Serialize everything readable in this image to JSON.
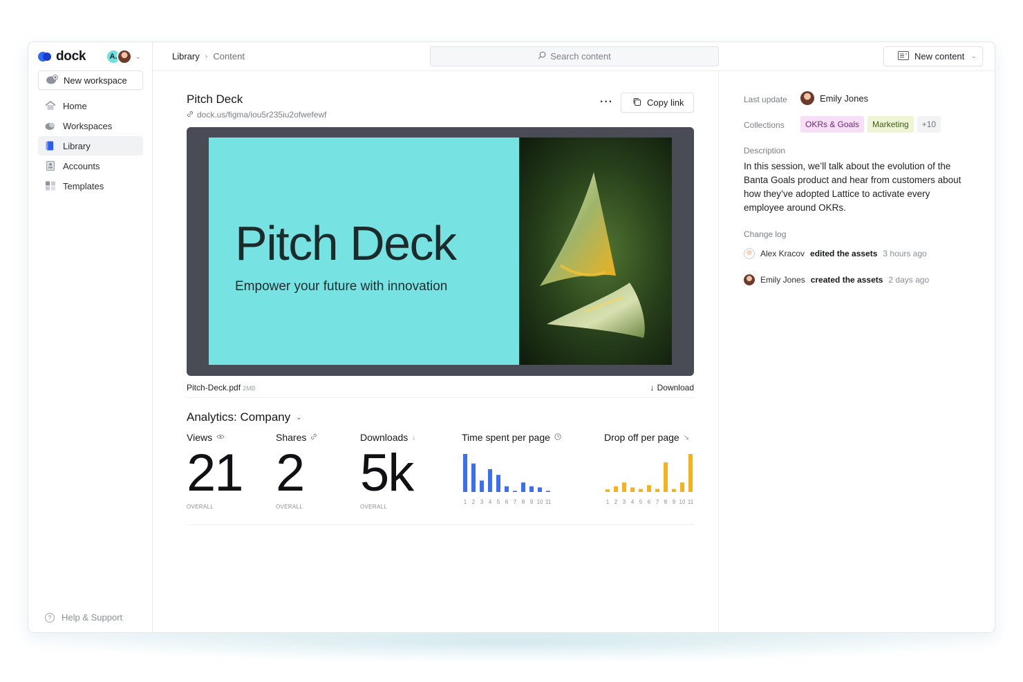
{
  "app": {
    "logo_text": "dock",
    "avatar_initial": "A."
  },
  "sidebar": {
    "new_workspace": "New workspace",
    "items": [
      {
        "label": "Home",
        "icon": "home-icon"
      },
      {
        "label": "Workspaces",
        "icon": "workspaces-icon"
      },
      {
        "label": "Library",
        "icon": "library-icon",
        "active": true
      },
      {
        "label": "Accounts",
        "icon": "accounts-icon"
      },
      {
        "label": "Templates",
        "icon": "templates-icon"
      }
    ],
    "help": "Help & Support"
  },
  "topbar": {
    "breadcrumb": [
      "Library",
      "Content"
    ],
    "search_placeholder": "Search content",
    "new_content": "New content"
  },
  "document": {
    "title": "Pitch Deck",
    "url": "dock.us/figma/iou5r235iu2ofwefewf",
    "copy_link": "Copy link",
    "slide_title": "Pitch Deck",
    "slide_subtitle": "Empower your future with innovation",
    "file_name": "Pitch-Deck.pdf",
    "file_size": "2MB",
    "download": "Download"
  },
  "analytics": {
    "heading": "Analytics: Company",
    "metrics": [
      {
        "label": "Views",
        "value": "21",
        "sub": "OVERALL",
        "icon": "eye-icon"
      },
      {
        "label": "Shares",
        "value": "2",
        "sub": "OVERALL",
        "icon": "link-icon"
      },
      {
        "label": "Downloads",
        "value": "5k",
        "sub": "OVERALL",
        "icon": "arrow-down-icon"
      }
    ],
    "time_label": "Time spent per page",
    "drop_label": "Drop off per page"
  },
  "chart_data": [
    {
      "type": "bar",
      "title": "Time spent per page",
      "categories": [
        "1",
        "2",
        "3",
        "4",
        "5",
        "6",
        "7",
        "8",
        "9",
        "10",
        "11"
      ],
      "values": [
        10,
        7.5,
        3,
        6,
        4.5,
        1.5,
        0.3,
        2.5,
        1.5,
        1.2,
        0.3
      ],
      "color": "#3b6ff2"
    },
    {
      "type": "bar",
      "title": "Drop off per page",
      "categories": [
        "1",
        "2",
        "3",
        "4",
        "5",
        "6",
        "7",
        "8",
        "9",
        "10",
        "11"
      ],
      "values": [
        0.7,
        1.5,
        2.5,
        1.2,
        0.8,
        1.8,
        0.8,
        7.8,
        0.8,
        2.5,
        10
      ],
      "color": "#f5b21d"
    }
  ],
  "details": {
    "last_update_label": "Last update",
    "last_update_user": "Emily Jones",
    "collections_label": "Collections",
    "tags": [
      "OKRs & Goals",
      "Marketing",
      "+10"
    ],
    "description_label": "Description",
    "description": "In this session, we’ll talk about the evolution of the Banta Goals product and hear from customers about how they’ve adopted Lattice to activate every employee around OKRs.",
    "changelog_label": "Change log",
    "changelog": [
      {
        "who": "Alex Kracov",
        "what": "edited the assets",
        "when": "3 hours ago"
      },
      {
        "who": "Emily Jones",
        "what": "created the assets",
        "when": "2 days ago"
      }
    ]
  }
}
